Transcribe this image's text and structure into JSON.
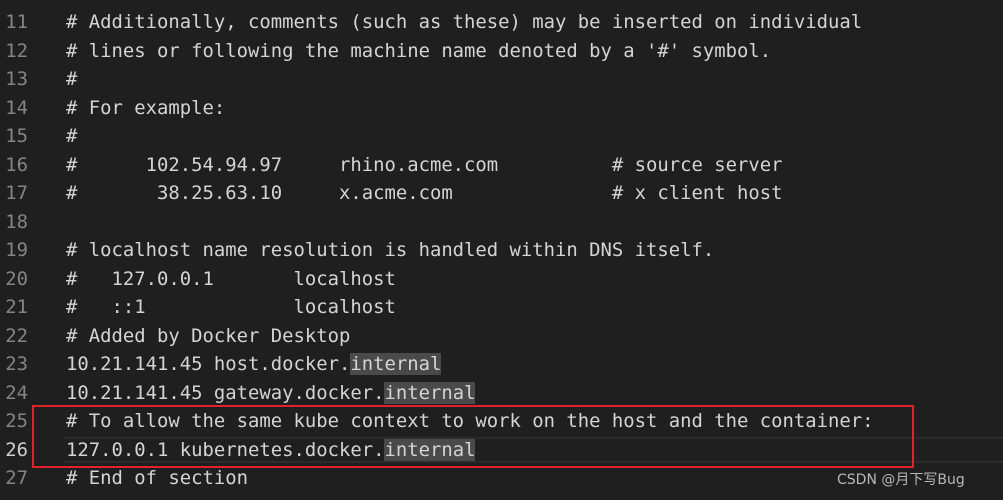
{
  "editor": {
    "active_line": 26,
    "lines": [
      {
        "n": "11",
        "text": "# Additionally, comments (such as these) may be inserted on individual"
      },
      {
        "n": "12",
        "text": "# lines or following the machine name denoted by a '#' symbol."
      },
      {
        "n": "13",
        "text": "#"
      },
      {
        "n": "14",
        "text": "# For example:"
      },
      {
        "n": "15",
        "text": "#"
      },
      {
        "n": "16",
        "text": "#      102.54.94.97     rhino.acme.com          # source server"
      },
      {
        "n": "17",
        "text": "#       38.25.63.10     x.acme.com              # x client host"
      },
      {
        "n": "18",
        "text": ""
      },
      {
        "n": "19",
        "text": "# localhost name resolution is handled within DNS itself."
      },
      {
        "n": "20",
        "text": "#   127.0.0.1       localhost"
      },
      {
        "n": "21",
        "text": "#   ::1             localhost"
      },
      {
        "n": "22",
        "text": "# Added by Docker Desktop"
      },
      {
        "n": "23",
        "text": "10.21.141.45 host.docker.",
        "hl": "internal"
      },
      {
        "n": "24",
        "text": "10.21.141.45 gateway.docker.",
        "hl": "internal"
      },
      {
        "n": "25",
        "text": "# To allow the same kube context to work on the host and the container:"
      },
      {
        "n": "26",
        "text": "127.0.0.1 kubernetes.docker.",
        "hl": "internal"
      },
      {
        "n": "27",
        "text": "# End of section"
      }
    ]
  },
  "annotation": {
    "color": "#e0232b"
  },
  "watermark": "CSDN @月下写Bug"
}
